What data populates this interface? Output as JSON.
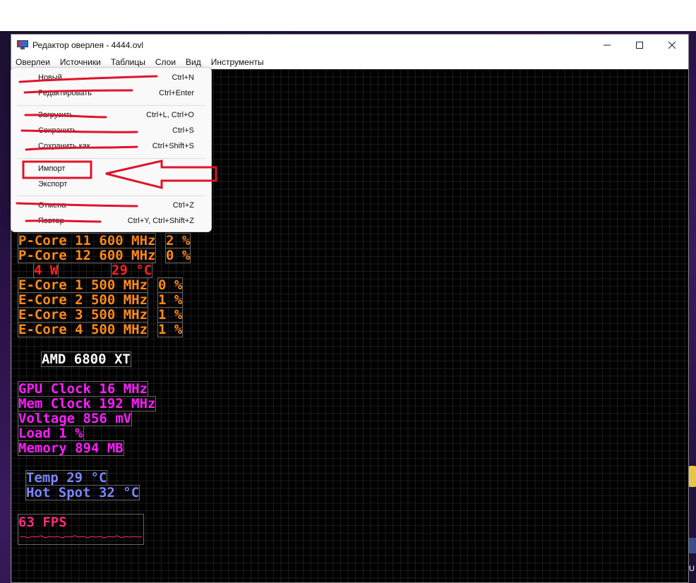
{
  "window": {
    "title": "Редактор оверлея - 4444.ovl",
    "minimize": "minimize",
    "maximize": "maximize",
    "close": "close"
  },
  "menubar": [
    "Оверлеи",
    "Источники",
    "Таблицы",
    "Слои",
    "Вид",
    "Инструменты"
  ],
  "dropdown": {
    "items": [
      {
        "label": "Новый",
        "shortcut": "Ctrl+N"
      },
      {
        "label": "Редактировать",
        "shortcut": "Ctrl+Enter"
      },
      {
        "label": "Загрузить",
        "shortcut": "Ctrl+L, Ctrl+O"
      },
      {
        "label": "Сохранить",
        "shortcut": "Ctrl+S"
      },
      {
        "label": "Сохранить как",
        "shortcut": "Ctrl+Shift+S"
      },
      {
        "label": "Импорт",
        "shortcut": ""
      },
      {
        "label": "Экспорт",
        "shortcut": ""
      },
      {
        "label": "Отмена",
        "shortcut": "Ctrl+Z"
      },
      {
        "label": "Повтор",
        "shortcut": "Ctrl+Y, Ctrl+Shift+Z"
      }
    ]
  },
  "overlay": {
    "pcore11": {
      "name": "P-Core 11 600 MHz",
      "load": "2 %"
    },
    "pcore12": {
      "name": "P-Core 12 600 MHz",
      "load": "0 %"
    },
    "cpu_power": "4 W",
    "cpu_temp": "29 °C",
    "ecore1": {
      "name": "E-Core 1 500 MHz",
      "load": "0 %"
    },
    "ecore2": {
      "name": "E-Core 2 500 MHz",
      "load": "1 %"
    },
    "ecore3": {
      "name": "E-Core 3 500 MHz",
      "load": "1 %"
    },
    "ecore4": {
      "name": "E-Core 4 500 MHz",
      "load": "1 %"
    },
    "gpu_name": "AMD 6800 XT",
    "gpu_clock": "GPU Clock 16 MHz",
    "mem_clock": "Mem Clock 192 MHz",
    "voltage": "Voltage 856 mV",
    "load": "Load 1 %",
    "memory": "Memory 894 MB",
    "temp": "Temp 29 °C",
    "hot_spot": "Hot Spot 32 °C",
    "fps": "63 FPS"
  },
  "colors": {
    "cpu": "#ff8a1a",
    "cpu_sensor": "#ff2020",
    "gpu": "#ff1cff",
    "temp": "#7d86ff",
    "fps": "#ff2a7a",
    "annotation": "#e0142a"
  }
}
